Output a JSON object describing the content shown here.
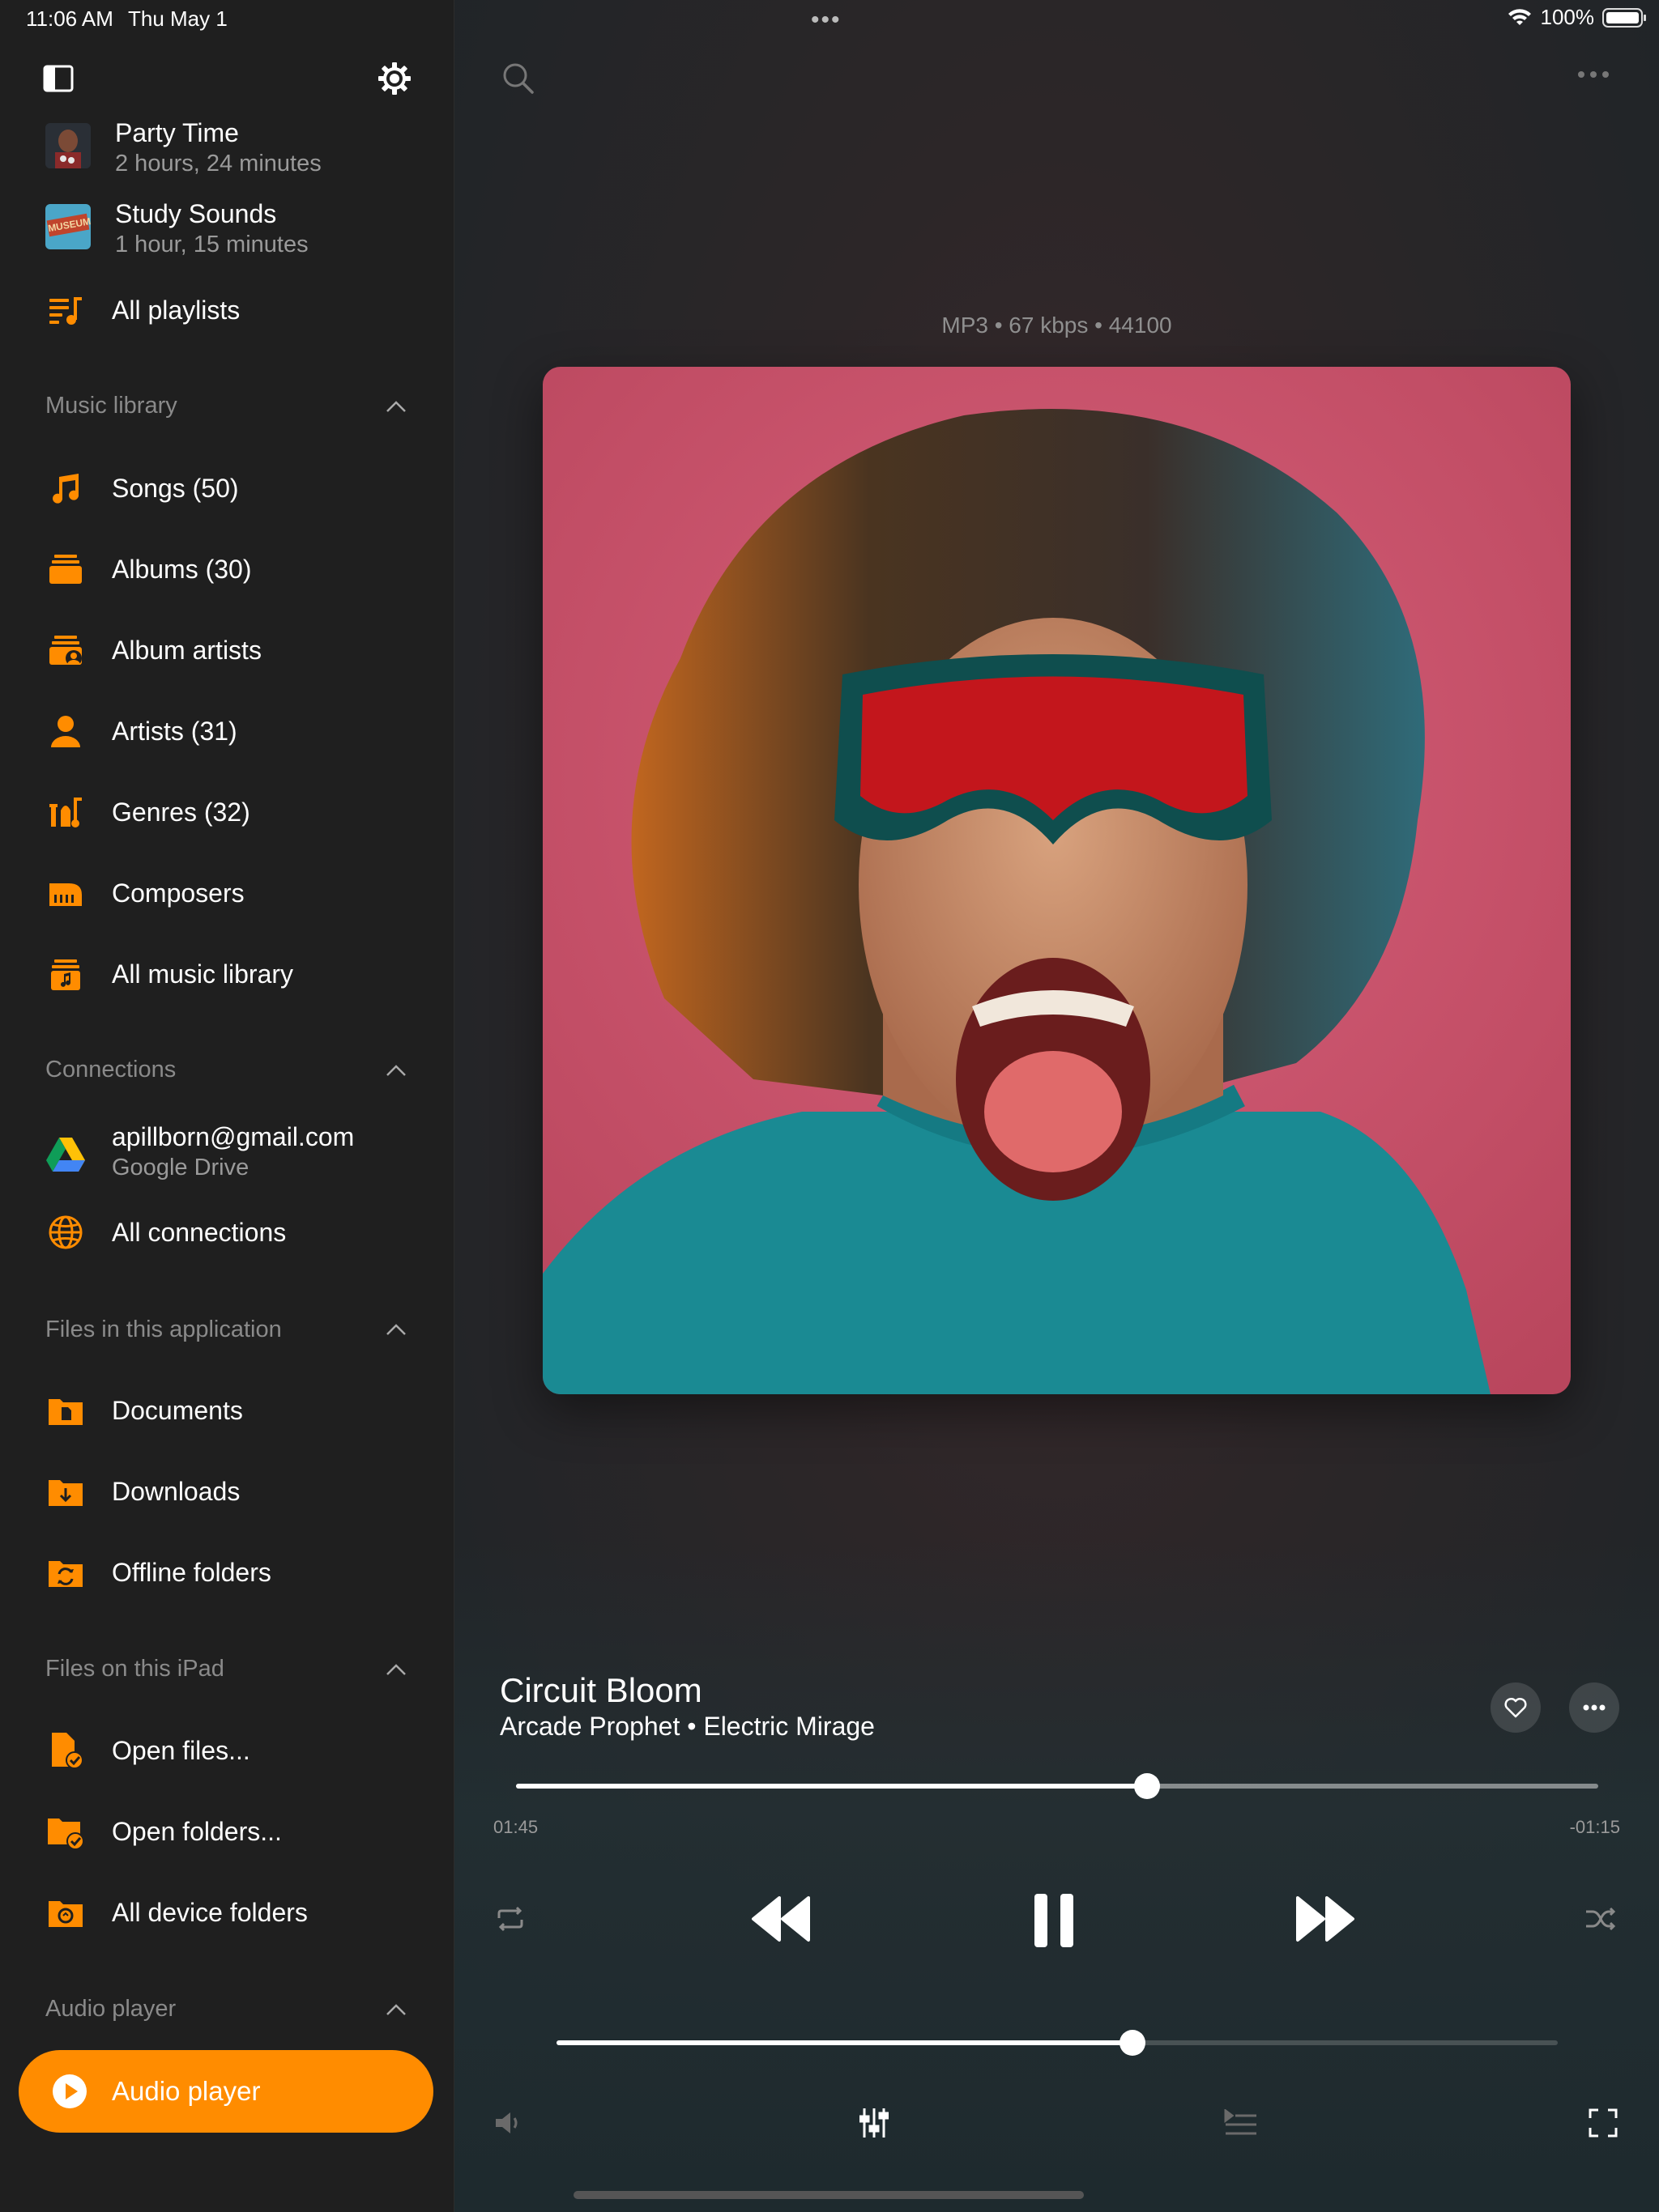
{
  "status": {
    "time": "11:06 AM",
    "date": "Thu May 1",
    "battery": "100%",
    "dots": "•••"
  },
  "sidebar": {
    "playlists": [
      {
        "title": "Party Time",
        "subtitle": "2 hours, 24 minutes"
      },
      {
        "title": "Study Sounds",
        "subtitle": "1 hour, 15 minutes",
        "thumb_text": "MUSEUM"
      }
    ],
    "all_playlists": "All playlists",
    "music_library": {
      "header": "Music library",
      "items": [
        {
          "label": "Songs (50)",
          "icon": "music-note-icon"
        },
        {
          "label": "Albums (30)",
          "icon": "albums-icon"
        },
        {
          "label": "Album artists",
          "icon": "album-artists-icon"
        },
        {
          "label": "Artists (31)",
          "icon": "artist-icon"
        },
        {
          "label": "Genres (32)",
          "icon": "genres-icon"
        },
        {
          "label": "Composers",
          "icon": "piano-icon"
        },
        {
          "label": "All music library",
          "icon": "music-library-icon"
        }
      ]
    },
    "connections": {
      "header": "Connections",
      "account": {
        "email": "apillborn@gmail.com",
        "service": "Google Drive"
      },
      "all": "All connections"
    },
    "files_app": {
      "header": "Files in this application",
      "items": [
        {
          "label": "Documents",
          "icon": "documents-folder-icon"
        },
        {
          "label": "Downloads",
          "icon": "downloads-folder-icon"
        },
        {
          "label": "Offline folders",
          "icon": "offline-folder-icon"
        }
      ]
    },
    "files_ipad": {
      "header": "Files on this iPad",
      "items": [
        {
          "label": "Open files...",
          "icon": "open-file-icon"
        },
        {
          "label": "Open folders...",
          "icon": "open-folder-icon"
        },
        {
          "label": "All device folders",
          "icon": "device-folders-icon"
        }
      ]
    },
    "audio_player": {
      "header": "Audio player",
      "button": "Audio player"
    }
  },
  "player": {
    "format": "MP3 • 67 kbps • 44100",
    "title": "Circuit Bloom",
    "subtitle": "Arcade Prophet • Electric Mirage",
    "elapsed": "01:45",
    "remaining": "-01:15",
    "progress_fraction": 0.583,
    "volume_fraction": 0.575
  },
  "colors": {
    "accent": "#ff8c00",
    "sidebar_bg": "#1f1f1f",
    "art_bg": "#c9506a"
  }
}
